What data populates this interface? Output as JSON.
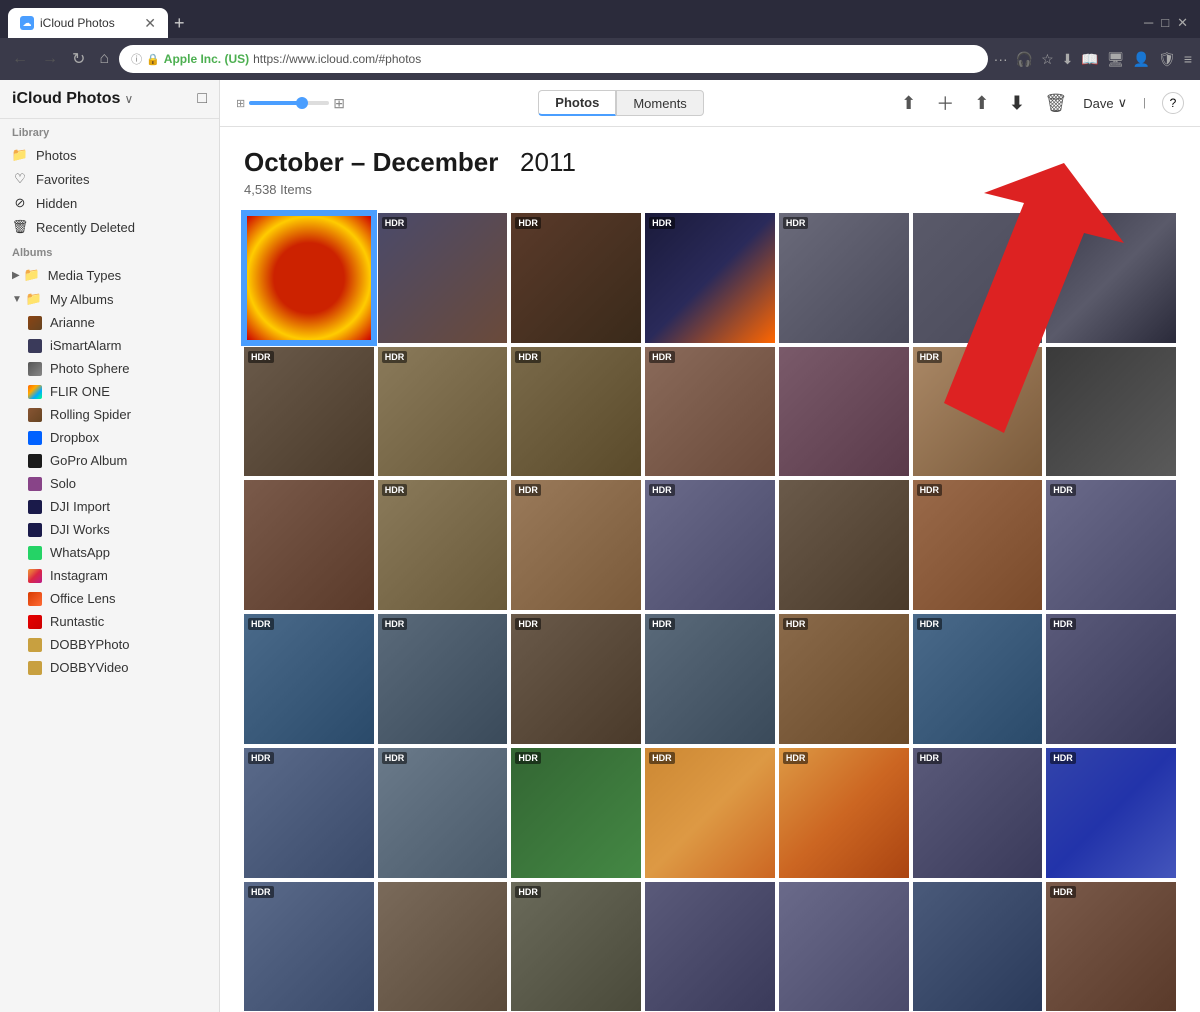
{
  "browser": {
    "tab_title": "iCloud Photos",
    "tab_new_label": "+",
    "nav_back": "←",
    "nav_forward": "→",
    "nav_refresh": "↻",
    "nav_home": "⌂",
    "address_site": "Apple Inc. (US)",
    "address_url": "https://www.icloud.com/#photos",
    "minimize": "─",
    "maximize": "□",
    "close": "✕"
  },
  "app": {
    "title": "iCloud Photos",
    "title_arrow": "∨",
    "sidebar_toggle": "□"
  },
  "toolbar": {
    "tab_photos": "Photos",
    "tab_moments": "Moments",
    "user_name": "Dave",
    "help": "?"
  },
  "album": {
    "date_range": "October – December",
    "year": "2011",
    "item_count": "4,538 Items"
  },
  "sidebar": {
    "library_label": "Library",
    "albums_label": "Albums",
    "library_items": [
      {
        "id": "photos",
        "label": "Photos",
        "icon": "folder"
      },
      {
        "id": "favorites",
        "label": "Favorites",
        "icon": "heart"
      },
      {
        "id": "hidden",
        "label": "Hidden",
        "icon": "hidden"
      },
      {
        "id": "recently-deleted",
        "label": "Recently Deleted",
        "icon": "trash"
      }
    ],
    "album_items": [
      {
        "id": "media-types",
        "label": "Media Types",
        "icon": "media",
        "expandable": true,
        "expanded": false
      },
      {
        "id": "my-albums",
        "label": "My Albums",
        "icon": "album",
        "expandable": true,
        "expanded": true
      },
      {
        "id": "arianne",
        "label": "Arianne",
        "icon": "arianne",
        "sub": true
      },
      {
        "id": "ismrt",
        "label": "iSmartAlarm",
        "icon": "ismrt",
        "sub": true
      },
      {
        "id": "photosph",
        "label": "Photo Sphere",
        "icon": "photosph",
        "sub": true
      },
      {
        "id": "flir",
        "label": "FLIR ONE",
        "icon": "flir",
        "sub": true
      },
      {
        "id": "rolling",
        "label": "Rolling Spider",
        "icon": "rolling",
        "sub": true
      },
      {
        "id": "dropbox",
        "label": "Dropbox",
        "icon": "dropbox",
        "sub": true
      },
      {
        "id": "gopro",
        "label": "GoPro Album",
        "icon": "gopro",
        "sub": true
      },
      {
        "id": "solo",
        "label": "Solo",
        "icon": "solo",
        "sub": true
      },
      {
        "id": "dji-import",
        "label": "DJI Import",
        "icon": "dji",
        "sub": true
      },
      {
        "id": "dji-works",
        "label": "DJI Works",
        "icon": "dji",
        "sub": true
      },
      {
        "id": "whatsapp",
        "label": "WhatsApp",
        "icon": "whatsapp",
        "sub": true
      },
      {
        "id": "instagram",
        "label": "Instagram",
        "icon": "instagram",
        "sub": true
      },
      {
        "id": "officelens",
        "label": "Office Lens",
        "icon": "officelens",
        "sub": true
      },
      {
        "id": "runtastic",
        "label": "Runtastic",
        "icon": "runtastic",
        "sub": true
      },
      {
        "id": "dobby-photo",
        "label": "DOBBYPhoto",
        "icon": "dobby",
        "sub": true
      },
      {
        "id": "dobby-video",
        "label": "DOBBYVideo",
        "icon": "dobby",
        "sub": true
      }
    ]
  },
  "photos": {
    "grid_rows": [
      [
        {
          "thumb": "thumb-1",
          "hdr": false,
          "selected": true
        },
        {
          "thumb": "thumb-2",
          "hdr": true,
          "selected": false
        },
        {
          "thumb": "thumb-3",
          "hdr": true,
          "selected": false
        },
        {
          "thumb": "thumb-4",
          "hdr": true,
          "selected": false
        },
        {
          "thumb": "thumb-5",
          "hdr": true,
          "selected": false
        },
        {
          "thumb": "thumb-6",
          "hdr": false,
          "selected": false
        },
        {
          "thumb": "thumb-7",
          "hdr": true,
          "selected": false
        }
      ],
      [
        {
          "thumb": "thumb-8",
          "hdr": true,
          "selected": false
        },
        {
          "thumb": "thumb-9",
          "hdr": true,
          "selected": false
        },
        {
          "thumb": "thumb-10",
          "hdr": true,
          "selected": false
        },
        {
          "thumb": "thumb-11",
          "hdr": true,
          "selected": false
        },
        {
          "thumb": "thumb-12",
          "hdr": false,
          "selected": false
        },
        {
          "thumb": "thumb-13",
          "hdr": true,
          "selected": false
        },
        {
          "thumb": "thumb-14",
          "hdr": false,
          "selected": false
        }
      ],
      [
        {
          "thumb": "thumb-15",
          "hdr": false,
          "selected": false
        },
        {
          "thumb": "thumb-16",
          "hdr": true,
          "selected": false
        },
        {
          "thumb": "thumb-17",
          "hdr": true,
          "selected": false
        },
        {
          "thumb": "thumb-18",
          "hdr": true,
          "selected": false
        },
        {
          "thumb": "thumb-19",
          "hdr": false,
          "selected": false
        },
        {
          "thumb": "thumb-20",
          "hdr": true,
          "selected": false
        },
        {
          "thumb": "thumb-21",
          "hdr": true,
          "selected": false
        }
      ],
      [
        {
          "thumb": "thumb-22",
          "hdr": true,
          "selected": false
        },
        {
          "thumb": "thumb-23",
          "hdr": true,
          "selected": false
        },
        {
          "thumb": "thumb-24",
          "hdr": true,
          "selected": false
        },
        {
          "thumb": "thumb-25",
          "hdr": true,
          "selected": false
        },
        {
          "thumb": "thumb-26",
          "hdr": true,
          "selected": false
        },
        {
          "thumb": "thumb-27",
          "hdr": true,
          "selected": false
        },
        {
          "thumb": "thumb-28",
          "hdr": true,
          "selected": false
        }
      ],
      [
        {
          "thumb": "thumb-29",
          "hdr": true,
          "selected": false
        },
        {
          "thumb": "thumb-30",
          "hdr": true,
          "selected": false
        },
        {
          "thumb": "plant",
          "hdr": true,
          "selected": false
        },
        {
          "thumb": "food1",
          "hdr": true,
          "selected": false
        },
        {
          "thumb": "food2",
          "hdr": true,
          "selected": false
        },
        {
          "thumb": "thumb-33",
          "hdr": true,
          "selected": false
        },
        {
          "thumb": "sign",
          "hdr": true,
          "selected": false
        }
      ]
    ],
    "hdr_label": "HDR"
  }
}
